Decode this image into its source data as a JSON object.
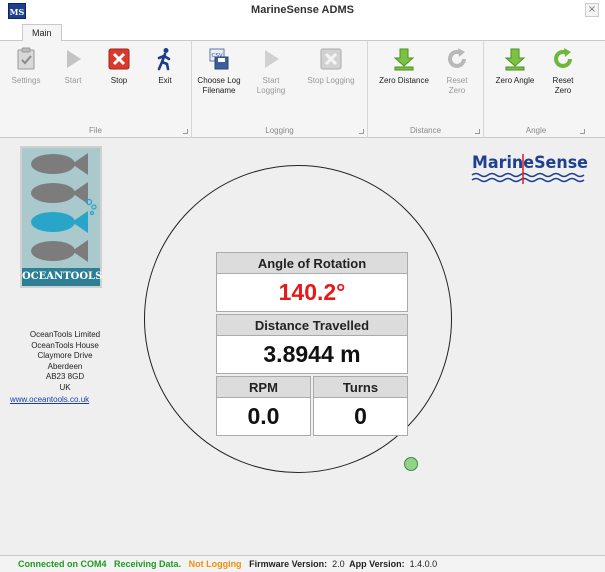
{
  "window": {
    "title": "MarineSense ADMS",
    "app_icon": "MS",
    "close_glyph": "×"
  },
  "tabs": [
    {
      "label": "Main",
      "active": true
    }
  ],
  "ribbon": {
    "groups": {
      "file": {
        "label": "File",
        "buttons": {
          "settings": {
            "label": "Settings",
            "icon": "clipboard-check-icon",
            "enabled": false
          },
          "start": {
            "label": "Start",
            "icon": "play-icon",
            "enabled": false
          },
          "stop": {
            "label": "Stop",
            "icon": "red-x-icon",
            "enabled": true
          },
          "exit": {
            "label": "Exit",
            "icon": "walking-person-icon",
            "enabled": true
          }
        }
      },
      "logging": {
        "label": "Logging",
        "buttons": {
          "choose": {
            "label": "Choose Log\nFilename",
            "icon": "csv-save-icon",
            "enabled": true
          },
          "start": {
            "label": "Start\nLogging",
            "icon": "play-icon",
            "enabled": false
          },
          "stop": {
            "label": "Stop Logging",
            "icon": "gray-x-icon",
            "enabled": false
          }
        }
      },
      "distance": {
        "label": "Distance",
        "buttons": {
          "zero": {
            "label": "Zero Distance",
            "icon": "green-down-arrow-icon",
            "enabled": true
          },
          "reset": {
            "label": "Reset\nZero",
            "icon": "refresh-icon",
            "enabled": false
          }
        }
      },
      "angle": {
        "label": "Angle",
        "buttons": {
          "zero": {
            "label": "Zero Angle",
            "icon": "green-down-arrow-icon",
            "enabled": true
          },
          "reset": {
            "label": "Reset\nZero",
            "icon": "green-refresh-icon",
            "enabled": true
          }
        }
      }
    }
  },
  "sidebar": {
    "logo_label": "OCEANTOOLS",
    "address": [
      "OceanTools Limited",
      "OceanTools House",
      "Claymore Drive",
      "Aberdeen",
      "AB23 8GD",
      "UK"
    ],
    "website": "www.oceantools.co.uk"
  },
  "brand": {
    "name": "MarineSense"
  },
  "readout": {
    "angle_label": "Angle of Rotation",
    "angle_value": "140.2°",
    "distance_label": "Distance Travelled",
    "distance_value": "3.8944 m",
    "rpm_label": "RPM",
    "rpm_value": "0.0",
    "turns_label": "Turns",
    "turns_value": "0"
  },
  "dial": {
    "marker_angle_deg": 140.2
  },
  "status": {
    "connected": "Connected on COM4",
    "receiving": "Receiving Data.",
    "logging": "Not Logging",
    "firmware_label": "Firmware Version:",
    "firmware_value": "2.0",
    "app_label": "App Version:",
    "app_value": "1.4.0.0"
  },
  "colors": {
    "angle_value": "#e51b1b",
    "status_green": "#1f9a1f",
    "status_orange": "#f0900a",
    "logo_blue": "#1f3f8f",
    "logo_teal": "#2c7f95"
  }
}
